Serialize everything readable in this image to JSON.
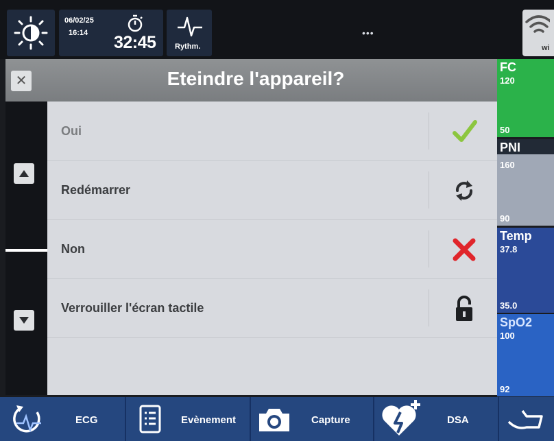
{
  "status_bar": {
    "date": "06/02/25",
    "time": "16:14",
    "timer": "32:45",
    "rhythm_label": "Rythm.",
    "status_dots": "•••",
    "wifi_label": "wi"
  },
  "dialog": {
    "title": "Eteindre l'appareil?",
    "options": [
      {
        "label": "Oui",
        "icon": "check-icon"
      },
      {
        "label": "Redémarrer",
        "icon": "refresh-icon"
      },
      {
        "label": "Non",
        "icon": "cross-icon"
      },
      {
        "label": "Verrouiller l'écran tactile",
        "icon": "lock-icon"
      }
    ]
  },
  "vitals": {
    "fc": {
      "name": "FC",
      "high": "120",
      "low": "50"
    },
    "pni": {
      "name": "PNI",
      "high": "160",
      "low": "90"
    },
    "temp": {
      "name": "Temp",
      "high": "37.8",
      "low": "35.0"
    },
    "spo2": {
      "name": "SpO2",
      "high": "100",
      "low": "92"
    }
  },
  "bottom_bar": {
    "ecg": "ECG",
    "event": "Evènement",
    "capture": "Capture",
    "dsa": "DSA"
  },
  "colors": {
    "check": "#8cc63f",
    "cross": "#e0252b",
    "fc_bg": "#2bb24a",
    "temp_bg": "#2b4a98",
    "spo2_bg": "#2a63c4",
    "bottom_bar_bg": "#25477f"
  }
}
